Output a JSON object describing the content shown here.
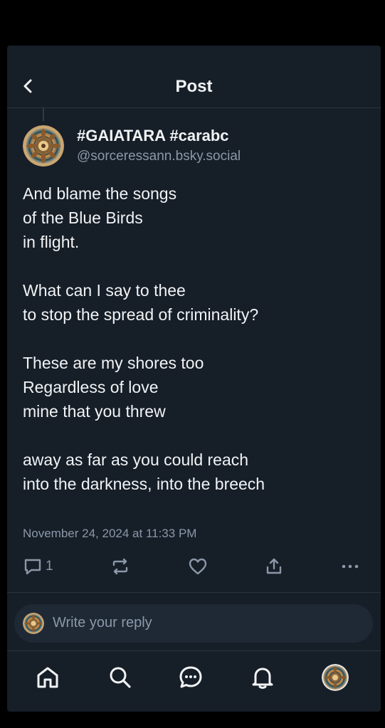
{
  "header": {
    "title": "Post",
    "back_icon": "chevron-left-icon"
  },
  "post": {
    "author": {
      "display_name": "#GAIATARA #carabc",
      "handle": "@sorceressann.bsky.social",
      "avatar_icon": "mandala-avatar"
    },
    "lines": [
      "And blame the songs",
      "of the Blue Birds",
      "in flight.",
      "",
      "What can I say to thee",
      "to stop the spread of criminality?",
      "",
      "These are my shores too",
      "Regardless of love",
      "mine that you threw",
      "",
      "away as far as you could reach",
      "into the darkness, into the breech"
    ],
    "timestamp": "November 24, 2024 at 11:33 PM",
    "reply_count": "1",
    "actions": [
      "reply-icon",
      "repost-icon",
      "heart-icon",
      "share-icon",
      "more-icon"
    ]
  },
  "reply_box": {
    "placeholder": "Write your reply"
  },
  "bottom_nav": {
    "items": [
      "home-icon",
      "search-icon",
      "chat-icon",
      "notifications-icon",
      "profile-avatar"
    ]
  },
  "colors": {
    "background": "#161e27",
    "text": "#f1f3f5",
    "muted": "#8b98a9",
    "divider": "#2a3441"
  }
}
